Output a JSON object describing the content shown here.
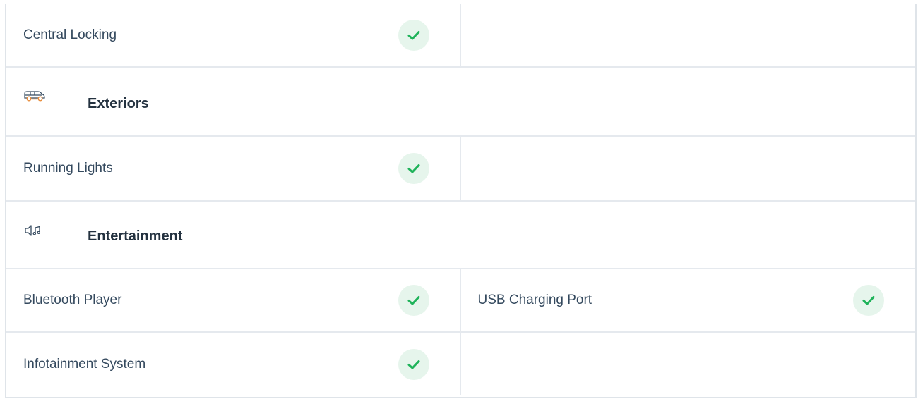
{
  "colors": {
    "check_bg": "#e6f5ec",
    "check_mark": "#1fb35a",
    "border": "#e5e9ee",
    "accent_orange": "#e88c3a"
  },
  "rows": {
    "central_locking": {
      "left_label": "Central Locking",
      "left_checked": true
    },
    "exteriors": {
      "title": "Exteriors",
      "icon": "car-icon"
    },
    "running_lights": {
      "left_label": "Running Lights",
      "left_checked": true
    },
    "entertainment": {
      "title": "Entertainment",
      "icon": "speaker-music-icon"
    },
    "bluetooth_usb": {
      "left_label": "Bluetooth Player",
      "left_checked": true,
      "right_label": "USB Charging Port",
      "right_checked": true
    },
    "infotainment": {
      "left_label": "Infotainment System",
      "left_checked": true
    }
  }
}
